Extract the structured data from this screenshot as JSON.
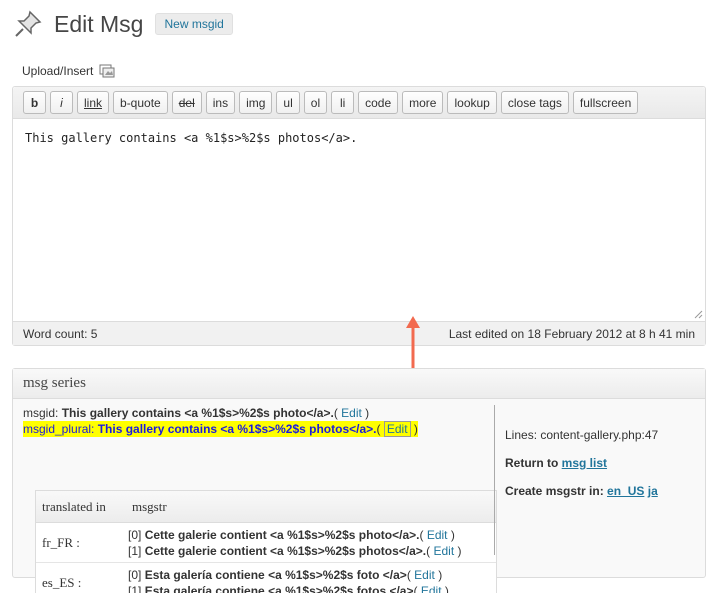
{
  "header": {
    "title": "Edit Msg",
    "new_button": "New msgid"
  },
  "upload": {
    "label": "Upload/Insert"
  },
  "toolbar": {
    "buttons": [
      "b",
      "i",
      "link",
      "b-quote",
      "del",
      "ins",
      "img",
      "ul",
      "ol",
      "li",
      "code",
      "more",
      "lookup",
      "close tags",
      "fullscreen"
    ]
  },
  "editor": {
    "content": "This gallery contains <a %1$s>%2$s photos</a>.",
    "word_count": "Word count: 5",
    "last_edited": "Last edited on 18 February 2012 at 8 h 41 min"
  },
  "series": {
    "title": "msg series",
    "msgid_key": "msgid: ",
    "msgid_value": "This gallery contains <a %1$s>%2$s photo</a>.",
    "msgid_plural_key": "msgid_plural: ",
    "msgid_plural_value": "This gallery contains <a %1$s>%2$s photos</a>.",
    "edit_label": "Edit",
    "open_paren": "( ",
    "close_paren": " )",
    "table_headers": {
      "lang": "translated in",
      "str": "msgstr"
    },
    "translations": [
      {
        "lang": "fr_FR :",
        "forms": [
          {
            "index": "[0] ",
            "text": "Cette galerie contient <a %1$s>%2$s photo</a>."
          },
          {
            "index": "[1] ",
            "text": "Cette galerie contient <a %1$s>%2$s photos</a>."
          }
        ]
      },
      {
        "lang": "es_ES :",
        "forms": [
          {
            "index": "[0] ",
            "text": "Esta galería contiene <a %1$s>%2$s foto </a>"
          },
          {
            "index": "[1] ",
            "text": "Esta galería contiene <a %1$s>%2$s fotos </a>"
          }
        ]
      }
    ],
    "lines": "Lines: content-gallery.php:47",
    "return_label": "Return to ",
    "return_link": "msg list",
    "create_label": "Create msgstr in:  ",
    "create_link_1": "en_US",
    "create_link_2": "ja"
  },
  "colors": {
    "link": "#21759b",
    "highlight": "#ffff00",
    "plural_text": "#1a1adf",
    "arrow": "#f26a4f"
  }
}
